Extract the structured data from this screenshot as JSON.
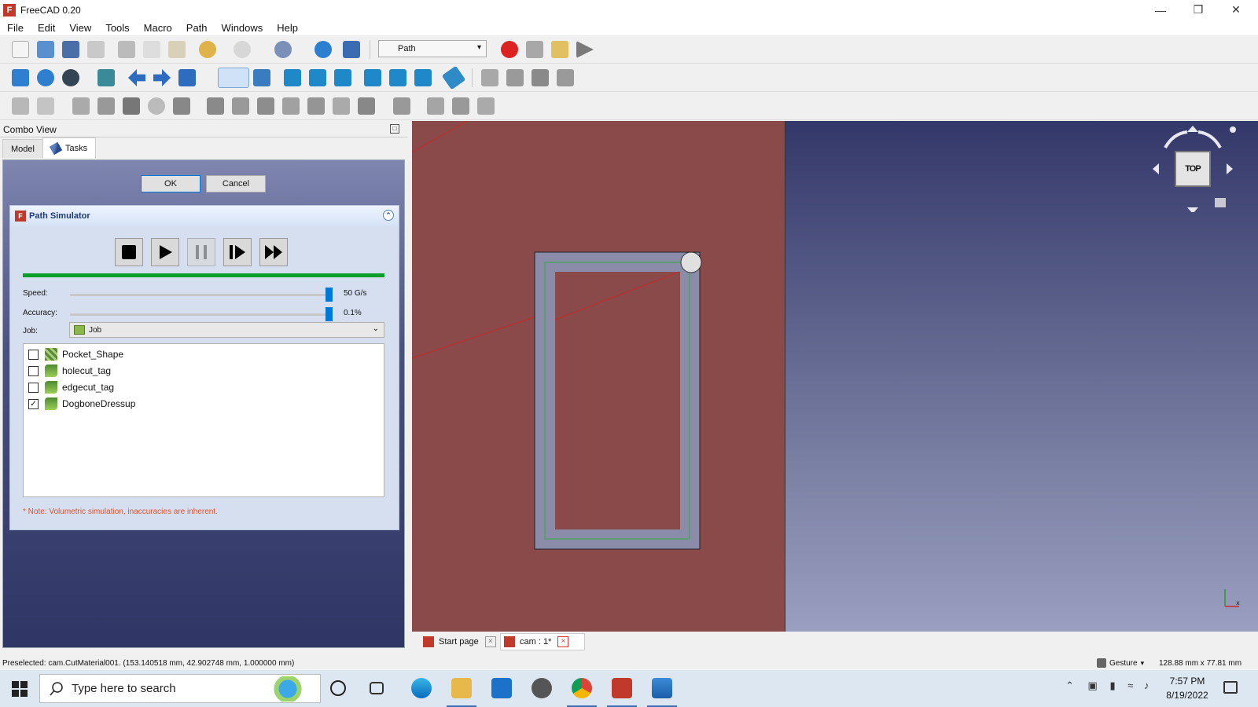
{
  "window": {
    "title": "FreeCAD 0.20",
    "controls": [
      "minimize",
      "restore",
      "close"
    ]
  },
  "menu": [
    "File",
    "Edit",
    "View",
    "Tools",
    "Macro",
    "Path",
    "Windows",
    "Help"
  ],
  "workbench": {
    "selected": "Path"
  },
  "combo_view": {
    "title": "Combo View",
    "tabs": [
      "Model",
      "Tasks"
    ],
    "active_tab": "Tasks"
  },
  "task_buttons": {
    "ok": "OK",
    "cancel": "Cancel"
  },
  "path_simulator": {
    "title": "Path Simulator",
    "controls": [
      "stop",
      "play",
      "pause",
      "step",
      "fast-forward"
    ],
    "progress": 1.0,
    "speed_label": "Speed:",
    "speed_value": "50 G/s",
    "accuracy_label": "Accuracy:",
    "accuracy_value": "0.1%",
    "job_label": "Job:",
    "job_value": "Job",
    "operations": [
      {
        "name": "Pocket_Shape",
        "checked": false,
        "icon": "pocket-op-icon"
      },
      {
        "name": "holecut_tag",
        "checked": false,
        "icon": "profile-op-icon"
      },
      {
        "name": "edgecut_tag",
        "checked": false,
        "icon": "profile-op-icon"
      },
      {
        "name": "DogboneDressup",
        "checked": true,
        "icon": "profile-op-icon"
      }
    ],
    "note": "* Note: Volumetric simulation, inaccuracies are inherent."
  },
  "navcube": {
    "face": "TOP"
  },
  "doc_tabs": [
    {
      "label": "Start page",
      "active": false
    },
    {
      "label": "cam : 1*",
      "active": true
    }
  ],
  "statusbar": {
    "text": "Preselected: cam.CutMaterial001. (153.140518 mm, 42.902748 mm, 1.000000 mm)",
    "nav_style": "Gesture",
    "dims": "128.88 mm x 77.81 mm"
  },
  "taskbar": {
    "search_placeholder": "Type here to search",
    "time": "7:57 PM",
    "date": "8/19/2022"
  },
  "colors": {
    "stock": "#8b4a4a",
    "toolpath": "#2fae3a",
    "progress": "#0a9f2a",
    "note": "#e0512a"
  }
}
